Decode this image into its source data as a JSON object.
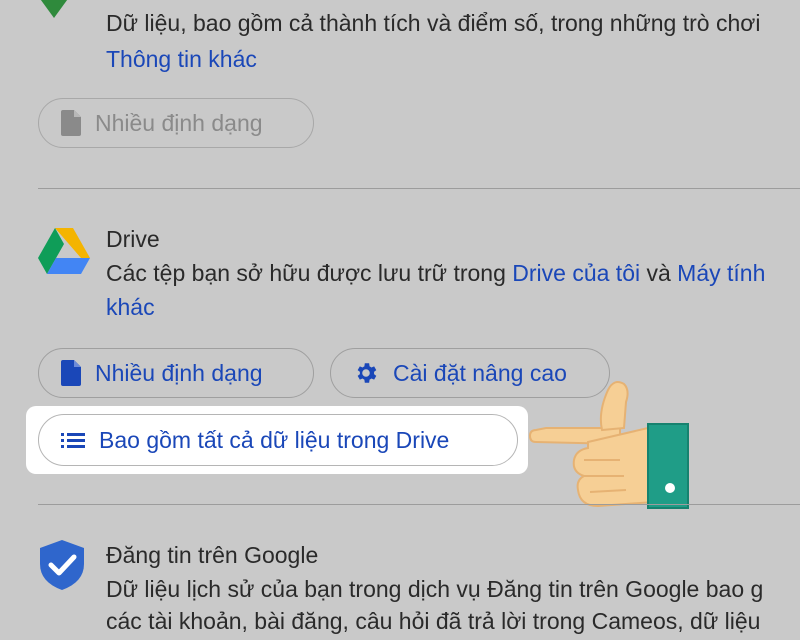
{
  "sections": [
    {
      "description_partial": "Dữ liệu, bao gồm cả thành tích và điểm số, trong những trò chơi",
      "link": "Thông tin khác",
      "chip_format": "Nhiều định dạng"
    },
    {
      "title": "Drive",
      "description_start": "Các tệp bạn sở hữu được lưu trữ trong ",
      "link1": "Drive của tôi",
      "and": " và ",
      "link2": "Máy tính",
      "link2_cont": "khác",
      "chip_format": "Nhiều định dạng",
      "chip_advanced": "Cài đặt nâng cao",
      "chip_include_all": "Bao gồm tất cả dữ liệu trong Drive"
    },
    {
      "title": "Đăng tin trên Google",
      "description_line1": "Dữ liệu lịch sử của bạn trong dịch vụ Đăng tin trên Google bao g",
      "description_line2": "các tài khoản, bài đăng, câu hỏi đã trả lời trong Cameos, dữ liệu"
    }
  ],
  "icons": {
    "games": "play-games-icon",
    "doc": "document-icon",
    "drive": "google-drive-icon",
    "gear": "gear-icon",
    "list": "list-icon",
    "shield": "shield-check-icon",
    "hand": "pointing-hand-icon"
  },
  "colors": {
    "link": "#1a47b8",
    "background": "#c9c9c9",
    "highlight": "#ffffff",
    "hand_skin": "#f6cf95",
    "hand_cuff": "#1f9d87"
  }
}
